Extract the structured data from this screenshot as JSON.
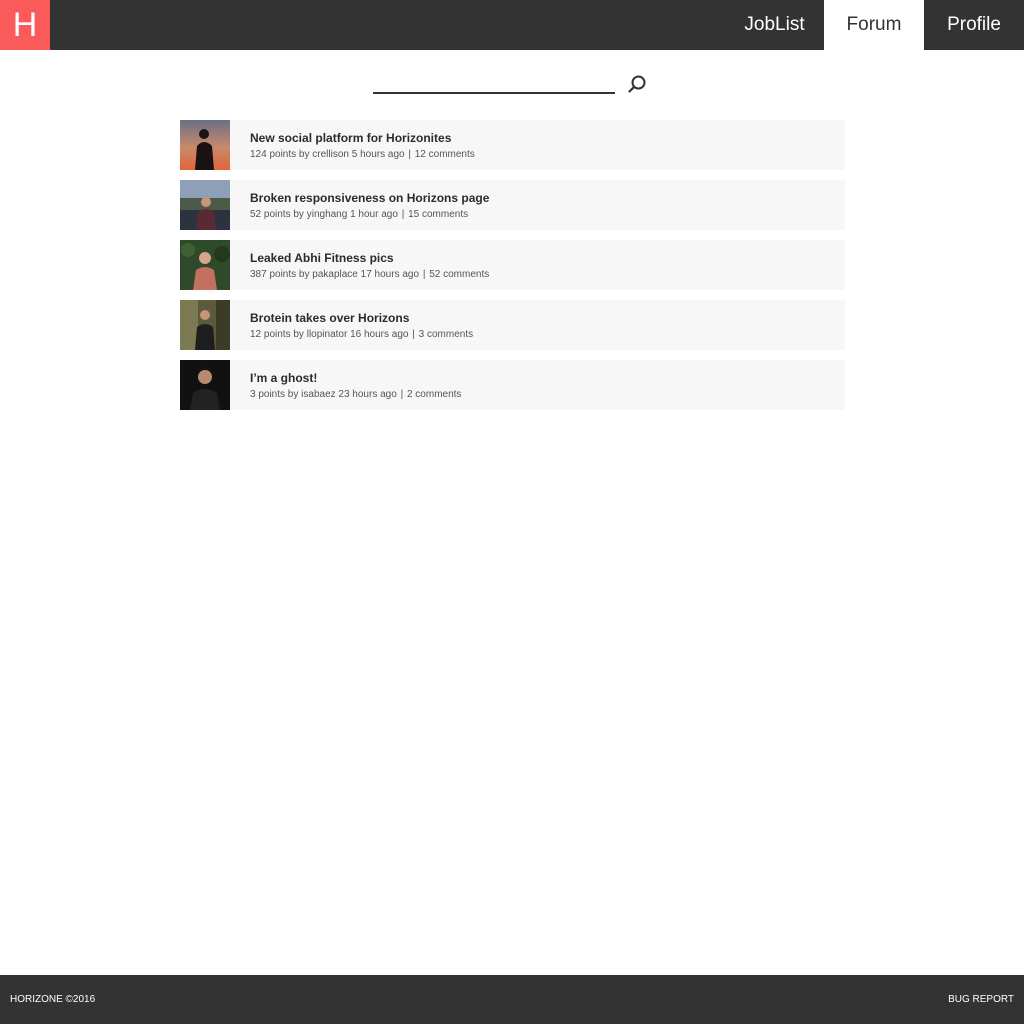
{
  "header": {
    "logo_letter": "H",
    "nav": [
      {
        "label": "JobList",
        "active": false
      },
      {
        "label": "Forum",
        "active": true
      },
      {
        "label": "Profile",
        "active": false
      }
    ]
  },
  "search": {
    "value": "",
    "placeholder": "",
    "icon": "search-icon"
  },
  "posts": [
    {
      "title": "New social platform for Horizonites",
      "points": "124 points",
      "author": "crellison",
      "time": "5 hours ago",
      "comments": "12 comments"
    },
    {
      "title": "Broken responsiveness on Horizons page",
      "points": "52 points",
      "author": "yinghang",
      "time": "1 hour ago",
      "comments": "15 comments"
    },
    {
      "title": "Leaked Abhi Fitness pics",
      "points": "387 points",
      "author": "pakaplace",
      "time": "17 hours ago",
      "comments": "52 comments"
    },
    {
      "title": "Brotein takes over Horizons",
      "points": "12 points",
      "author": "llopinator",
      "time": "16 hours ago",
      "comments": "3 comments"
    },
    {
      "title": "I’m a ghost!",
      "points": "3 points",
      "author": "isabaez",
      "time": "23 hours ago",
      "comments": "2 comments"
    }
  ],
  "footer": {
    "copyright": "HORIZONE ©2016",
    "bug_report": "BUG REPORT"
  },
  "colors": {
    "brand": "#fa5a5a",
    "bar": "#333333",
    "row_bg": "#f7f7f7"
  }
}
